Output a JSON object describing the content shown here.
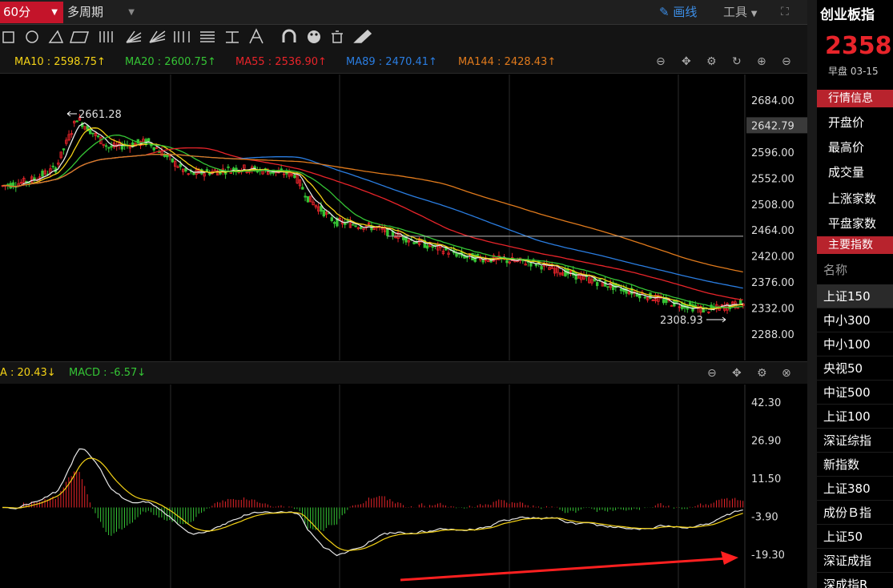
{
  "toolbar": {
    "period": "60分",
    "multi_period": "多周期",
    "draw": "画线",
    "tools": "工具"
  },
  "ma_legend": [
    {
      "label": "MA10 : 2598.75↑",
      "color": "#f5d316"
    },
    {
      "label": "MA20 : 2600.75↑",
      "color": "#35c535"
    },
    {
      "label": "MA55 : 2536.90↑",
      "color": "#e8242a"
    },
    {
      "label": "MA89 : 2470.41↑",
      "color": "#2a7de1"
    },
    {
      "label": "MA144 : 2428.43↑",
      "color": "#e07a1c"
    }
  ],
  "macd_legend": [
    {
      "label": "A : 20.43↓",
      "color": "#f5d316"
    },
    {
      "label": "MACD : -6.57↓",
      "color": "#35c535"
    }
  ],
  "price_axis": [
    "2684.00",
    "2640.00",
    "2596.00",
    "2552.00",
    "2508.00",
    "2464.00",
    "2420.00",
    "2376.00",
    "2332.00",
    "2288.00"
  ],
  "current_price_tag": "2642.79",
  "high_label": "2661.28",
  "low_label": "2308.93",
  "macd_axis": [
    "42.30",
    "26.90",
    "11.50",
    "-3.90",
    "-19.30"
  ],
  "colors": {
    "up": "#e8242a",
    "down": "#35c535",
    "ma10": "#f5d316",
    "ma20": "#35c535",
    "ma55": "#e8242a",
    "ma89": "#2a7de1",
    "ma144": "#e07a1c",
    "dif": "#e8e8e8",
    "dea": "#f5d316"
  },
  "side": {
    "title": "创业板指",
    "price": "2358.",
    "session": "早盘  03-15",
    "quote_header": "行情信息",
    "quote_rows": [
      "开盘价",
      "最高价",
      "成交量",
      "上涨家数",
      "平盘家数"
    ],
    "index_header": "主要指数",
    "name_header": "名称",
    "indices": [
      "上证150",
      "中小300",
      "中小100",
      "央视50",
      "中证500",
      "上证100",
      "深证综指",
      "新指数",
      "上证380",
      "成份Ｂ指",
      "上证50",
      "深证成指",
      "深成指R"
    ]
  }
}
